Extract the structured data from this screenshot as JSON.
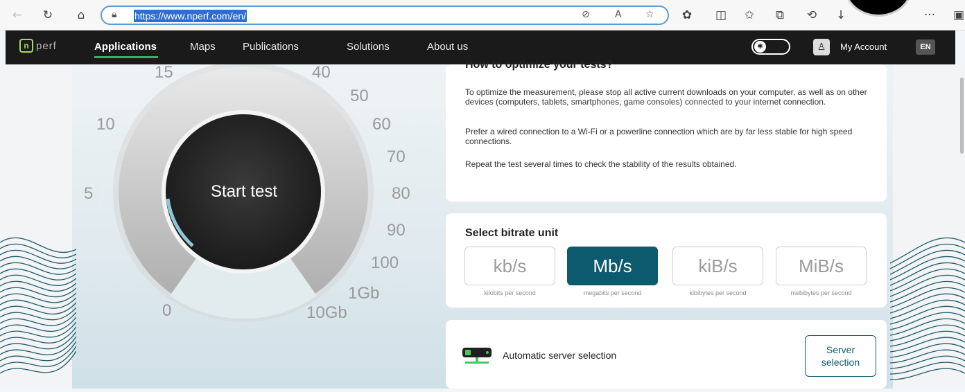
{
  "browser": {
    "url": "https://www.nperf.com/en/",
    "icons": [
      "back-icon",
      "refresh-icon",
      "home-icon",
      "lock-icon",
      "tracking-icon",
      "read-aloud-icon",
      "favorite-icon",
      "extensions-icon",
      "split-screen-icon",
      "favorites-icon",
      "collections-icon",
      "history-icon",
      "download-icon",
      "more-icon",
      "sidebar-icon"
    ],
    "more_label": "···"
  },
  "nav": {
    "logo_mark": "n",
    "logo_word": "perf",
    "items": [
      {
        "label": "Applications",
        "active": true
      },
      {
        "label": "Maps",
        "active": false
      },
      {
        "label": "Publications",
        "active": false
      },
      {
        "label": "Solutions",
        "active": false
      },
      {
        "label": "About us",
        "active": false
      }
    ],
    "account_label": "My Account",
    "language": "EN"
  },
  "gauge": {
    "tick_labels": [
      "0",
      "5",
      "10",
      "15",
      "40",
      "50",
      "60",
      "70",
      "80",
      "90",
      "100",
      "1Gb",
      "10Gb"
    ],
    "start_label": "Start test"
  },
  "optimize": {
    "title": "How to optimize your tests?",
    "paragraphs": [
      "To optimize the measurement, please stop all active current downloads on your computer, as well as on other devices (computers, tablets, smartphones, game consoles) connected to your internet connection.",
      "Prefer a wired connection to a Wi-Fi or a powerline connection which are by far less stable for high speed connections.",
      "Repeat the test several times to check the stability of the results obtained."
    ]
  },
  "bitrate": {
    "title": "Select bitrate unit",
    "units": [
      {
        "label": "kb/s",
        "sub": "kilobits per second",
        "selected": false
      },
      {
        "label": "Mb/s",
        "sub": "megabits per second",
        "selected": true
      },
      {
        "label": "kiB/s",
        "sub": "kibibytes per second",
        "selected": false
      },
      {
        "label": "MiB/s",
        "sub": "mebibytes per second",
        "selected": false
      }
    ],
    "selected_color": "#0d5a6e"
  },
  "server": {
    "label": "Automatic server selection",
    "button_label": "Server selection"
  },
  "colors": {
    "nav_bg": "#1a1a1a",
    "nav_active_underline": "#2fb36a",
    "accent": "#0d5a6e",
    "logo_green": "#9fe05a"
  }
}
